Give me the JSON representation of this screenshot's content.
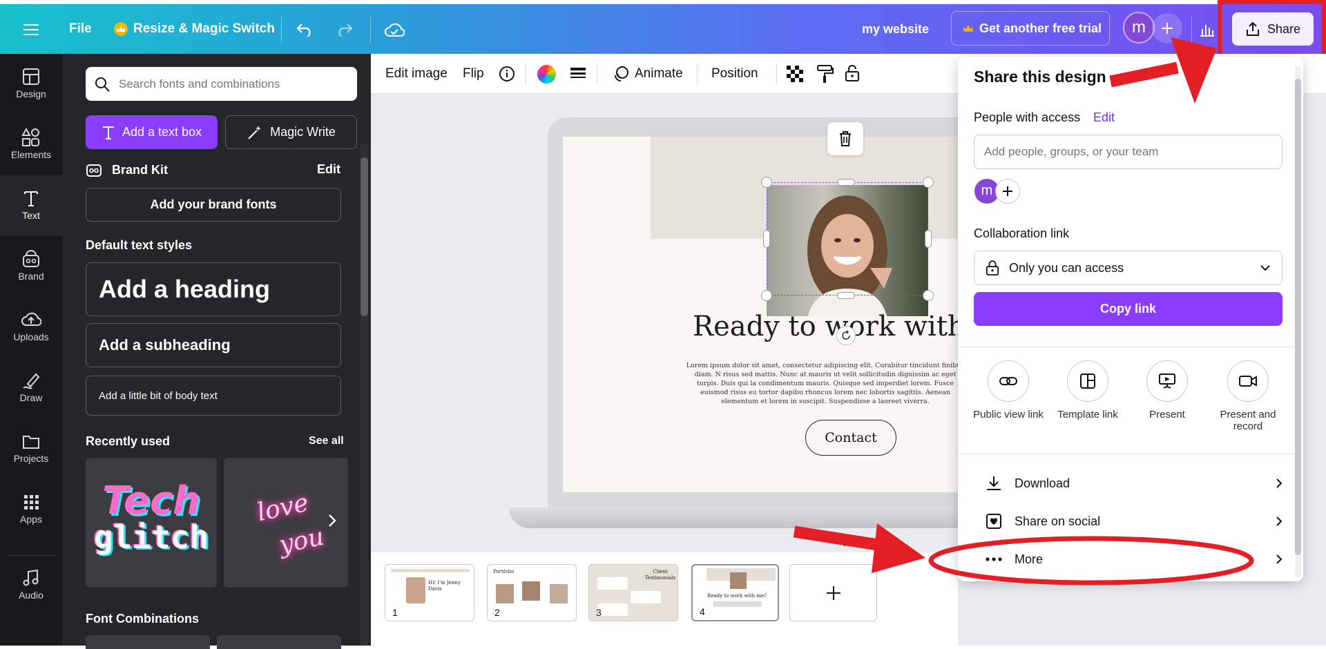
{
  "topbar": {
    "file": "File",
    "resize": "Resize & Magic Switch",
    "design_name": "my website",
    "trial": "Get another free trial",
    "avatar_letter": "m",
    "share": "Share"
  },
  "rail": [
    {
      "label": "Design",
      "icon": "design-icon"
    },
    {
      "label": "Elements",
      "icon": "elements-icon"
    },
    {
      "label": "Text",
      "icon": "text-icon"
    },
    {
      "label": "Brand",
      "icon": "brand-icon"
    },
    {
      "label": "Uploads",
      "icon": "uploads-icon"
    },
    {
      "label": "Draw",
      "icon": "draw-icon"
    },
    {
      "label": "Projects",
      "icon": "projects-icon"
    },
    {
      "label": "Apps",
      "icon": "apps-icon"
    },
    {
      "label": "Audio",
      "icon": "audio-icon"
    }
  ],
  "panel": {
    "search_placeholder": "Search fonts and combinations",
    "add_text_box": "Add a text box",
    "magic_write": "Magic Write",
    "brand_kit": "Brand Kit",
    "brand_kit_edit": "Edit",
    "add_brand_fonts": "Add your brand fonts",
    "default_styles": "Default text styles",
    "heading": "Add a heading",
    "subheading": "Add a subheading",
    "body": "Add a little bit of body text",
    "recently_used": "Recently used",
    "see_all": "See all",
    "recent_1_line1": "Tech",
    "recent_1_line2": "glitch",
    "recent_2_line1": "love",
    "recent_2_line2": "you",
    "font_combinations": "Font Combinations"
  },
  "context_bar": {
    "edit_image": "Edit image",
    "flip": "Flip",
    "animate": "Animate",
    "position": "Position"
  },
  "canvas": {
    "headline": "Ready to work with m",
    "body_text": "Lorem ipsum dolor sit amet, consectetur adipiscing elit. Curabitur tincidunt finibus diam. N risus sed mattis. Nunc at mauris ut velit sollicitudin dignissim ac eget turpis. Duis qui la condimentum mauris. Quisque sed imperdiet lorem. Fusce euismod risus eu tortor dapibu rhoncus lorem nec lobortis sagittis. Aenean elementum et lorem in suscipit. Suspendisse a laoreet viverra.",
    "contact": "Contact"
  },
  "pages": [
    {
      "num": "1",
      "title": "Hi! I'm Jenny Davis"
    },
    {
      "num": "2",
      "title": "Portfolio"
    },
    {
      "num": "3",
      "title": "Client Testimonials"
    },
    {
      "num": "4",
      "title": "Ready to work with me?"
    }
  ],
  "share": {
    "title": "Share this design",
    "people_label": "People with access",
    "people_edit": "Edit",
    "add_people_placeholder": "Add people, groups, or your team",
    "avatar_letter": "m",
    "collab_label": "Collaboration link",
    "access": "Only you can access",
    "copy_link": "Copy link",
    "options": [
      {
        "label": "Public view link",
        "icon": "link-icon"
      },
      {
        "label": "Template link",
        "icon": "template-icon"
      },
      {
        "label": "Present",
        "icon": "present-icon"
      },
      {
        "label": "Present and record",
        "icon": "camera-icon"
      }
    ],
    "rows": [
      {
        "label": "Download",
        "icon": "download-icon"
      },
      {
        "label": "Share on social",
        "icon": "heart-icon"
      },
      {
        "label": "More",
        "icon": "more-icon"
      }
    ]
  },
  "colors": {
    "accent": "#7d2ae8",
    "annotation": "#e31e24",
    "rail_bg": "#18191b",
    "panel_bg": "#252627"
  }
}
